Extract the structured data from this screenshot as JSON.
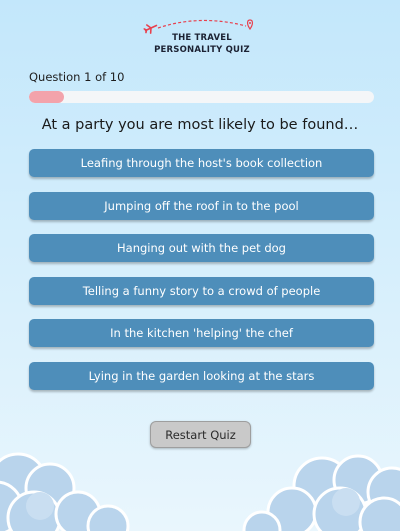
{
  "logo": {
    "line1": "THE TRAVEL",
    "line2": "PERSONALITY QUIZ",
    "plane_icon": "airplane-icon",
    "pin_icon": "map-pin-icon"
  },
  "progress": {
    "label": "Question 1 of 10",
    "fraction": 0.1
  },
  "question": "At a party you are most likely to be found…",
  "options": [
    "Leafing through the host's book collection",
    "Jumping off the roof in to the pool",
    "Hanging out with the pet dog",
    "Telling a funny story to a crowd of people",
    "In the kitchen 'helping' the chef",
    "Lying in the garden looking at the stars"
  ],
  "restart_label": "Restart Quiz",
  "colors": {
    "option_bg": "#4e8eba",
    "progress_fill": "#f3a3ab",
    "logo_accent": "#e8404d",
    "cloud": "#b9d4ec"
  }
}
